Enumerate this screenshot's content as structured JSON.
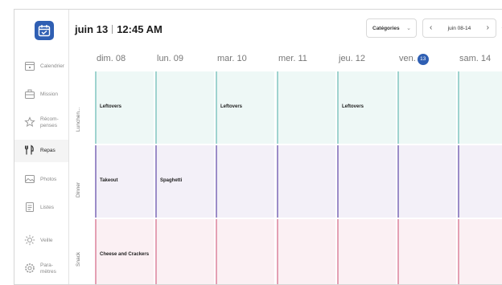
{
  "header": {
    "date": "juin 13",
    "time": "12:45 AM",
    "categories_label": "Catégories",
    "week_range": "juin 08-14"
  },
  "sidebar": {
    "items": [
      {
        "label": "Calendrier",
        "icon": "calendar-icon"
      },
      {
        "label": "Mission",
        "icon": "briefcase-icon"
      },
      {
        "label": "Récom-\npenses",
        "icon": "star-icon"
      },
      {
        "label": "Repas",
        "icon": "utensils-icon",
        "active": true
      },
      {
        "label": "Photos",
        "icon": "photos-icon"
      },
      {
        "label": "Listes",
        "icon": "list-icon"
      },
      {
        "label": "Veille",
        "icon": "sun-icon"
      },
      {
        "label": "Para-\nmètres",
        "icon": "gear-icon"
      }
    ]
  },
  "days": [
    {
      "label": "dim. 08"
    },
    {
      "label": "lun. 09"
    },
    {
      "label": "mar. 10"
    },
    {
      "label": "mer. 11"
    },
    {
      "label": "jeu. 12"
    },
    {
      "label": "ven.",
      "badge": "13",
      "today": true
    },
    {
      "label": "sam. 14"
    }
  ],
  "meal_rows": [
    {
      "label": "Lunchen...",
      "bar_color": "#9fd3cf",
      "bg_color": "#eef8f6",
      "cells": [
        "Leftovers",
        "",
        "Leftovers",
        "",
        "Leftovers",
        "",
        ""
      ]
    },
    {
      "label": "Dinner",
      "bar_color": "#9b8cc8",
      "bg_color": "#f3f0f8",
      "cells": [
        "Takeout",
        "Spaghetti",
        "",
        "",
        "",
        "",
        ""
      ]
    },
    {
      "label": "Snack",
      "bar_color": "#e4a0b3",
      "bg_color": "#fbf0f3",
      "cells": [
        "Cheese and Crackers",
        "",
        "",
        "",
        "",
        "",
        ""
      ]
    }
  ]
}
